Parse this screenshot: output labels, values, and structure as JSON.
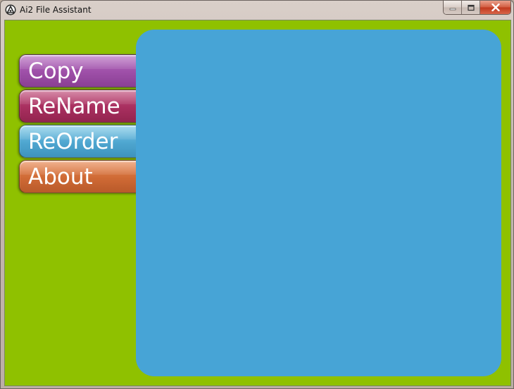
{
  "window": {
    "title": "Ai2 File Assistant",
    "icon": "ai2-app-icon",
    "controls": [
      "minimize-icon",
      "maximize-icon",
      "close-icon"
    ]
  },
  "menu": {
    "items": [
      {
        "label": "Copy",
        "color": "#9e4fa8"
      },
      {
        "label": "ReName",
        "color": "#a82f5f"
      },
      {
        "label": "ReOrder",
        "color": "#4ea6d0"
      },
      {
        "label": "About",
        "color": "#cf6a35"
      }
    ]
  },
  "colors": {
    "background": "#8fc100",
    "content_panel": "#47a4d6"
  }
}
